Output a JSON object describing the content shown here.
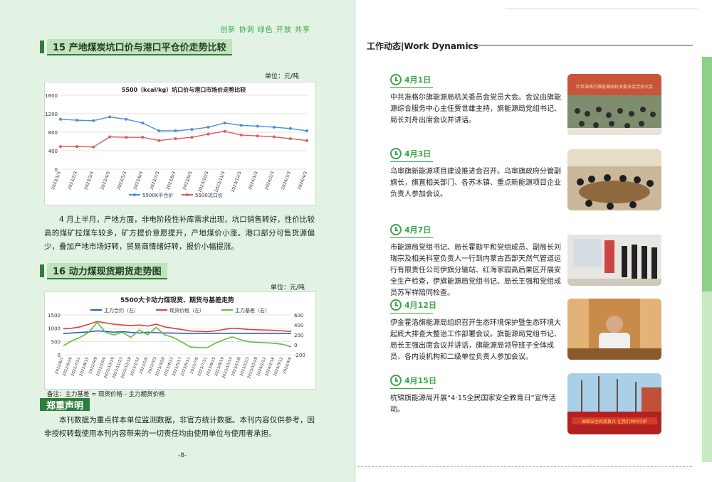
{
  "left_page": {
    "slogan": "创新 协调 绿色 开放 共享",
    "section15": {
      "title": "15 产地煤炭坑口价与港口平仓价走势比较",
      "unit": "单位：元/吨",
      "paragraph": "4 月上半月，产地方面，非电阶段性补库需求出现，坑口销售转好，性价比较高的煤矿拉煤车较多，矿方提价意愿提升，产地煤价小涨。港口部分可售货源偏少，叠加产地市场好转，贸易商情绪好转，报价小幅提涨。"
    },
    "section16": {
      "title": "16 动力煤现货期货走势图",
      "unit": "单位：元/吨",
      "note": "备注：主力基差 = 现货价格 - 主力期货价格"
    },
    "declaration": {
      "title": "郑重声明",
      "text": "本刊数据为重点样本单位监测数据，非官方统计数据。本刊内容仅供参考，因非授权转载使用本刊内容带来的一切责任均由使用单位与使用者承担。"
    },
    "page_number": "-8-"
  },
  "right_page": {
    "title": "工作动态|Work Dynamics",
    "events": [
      {
        "date": "4月1日",
        "text": "中共准格尔旗能源局机关委员会党员大会。会议由旗能源综合服务中心主任贾世雄主持，旗能源局党组书记、局长刘舟出席会议并讲话。",
        "photo_caption": "中共准格尔旗能源局机关委员会党员大会"
      },
      {
        "date": "4月3日",
        "text": "乌审旗新能源项目建设推进会召开。乌审旗政府分管副旗长，旗直相关部门、各苏木镇、重点新能源项目企业负责人参加会议。",
        "photo_caption": ""
      },
      {
        "date": "4月7日",
        "text": "市能源局党组书记、局长霍勘平和党组成员、副局长刘瑞宗及相关科室负责人一行到内蒙古西部天然气管道运行有限责任公司伊旗分输站、红海家园高后果区开展安全生产检查，伊旗能源局党组书记、局长王强和党组成员苏军祥陪同检查。",
        "photo_caption": ""
      },
      {
        "date": "4月12日",
        "text": "伊金霍洛旗能源局组织召开生态环境保护暨生态环境大起底大排查大整治工作部署会议。旗能源局党组书记、局长王强出席会议并讲话，旗能源局领导班子全体成员、各内设机构和二级单位负责人参加会议。",
        "photo_caption": ""
      },
      {
        "date": "4月15日",
        "text": "杭锦旗能源局开展“4·15全民国家安全教育日”宣传活动。",
        "photo_caption": "国家安全民族复兴  让我们共同守护"
      }
    ]
  },
  "chart_data": [
    {
      "type": "line",
      "title": "5500（kcal/kg）坑口价与港口市场价走势比较",
      "x": [
        "2023/1/3",
        "2023/2/3",
        "2023/3/3",
        "2023/4/3",
        "2023/5/3",
        "2023/6/3",
        "2023/7/3",
        "2023/8/3",
        "2023/9/3",
        "2023/10/3",
        "2023/11/3",
        "2023/12/3",
        "2024/1/3",
        "2024/2/3",
        "2024/3/3",
        "2024/4/3"
      ],
      "series": [
        {
          "name": "5500K平仓价",
          "color": "#4a8fd6",
          "values": [
            1080,
            1060,
            1050,
            1130,
            1080,
            1000,
            830,
            830,
            860,
            910,
            1000,
            950,
            930,
            910,
            880,
            830
          ]
        },
        {
          "name": "5500坑口价",
          "color": "#e05a5a",
          "values": [
            490,
            490,
            480,
            700,
            690,
            690,
            620,
            660,
            690,
            760,
            820,
            740,
            720,
            700,
            660,
            620
          ]
        }
      ],
      "ylim": [
        0,
        1600
      ],
      "yticks": [
        0,
        400,
        800,
        1200,
        1600
      ],
      "grid": true,
      "legend": "bottom"
    },
    {
      "type": "line",
      "title": "5500大卡动力煤现货、期货与基差走势",
      "x": [
        "2022/6/1",
        "2022/6/26",
        "2022/7/21",
        "2022/8/15",
        "2022/9/9",
        "2022/10/4",
        "2022/10/29",
        "2022/11/23",
        "2022/12/18",
        "2023/1/12",
        "2023/2/6",
        "2023/3/3",
        "2023/3/28",
        "2023/4/22",
        "2023/5/17",
        "2023/6/11",
        "2023/7/6",
        "2023/7/31",
        "2023/8/25",
        "2023/9/19",
        "2023/10/14",
        "2023/11/8",
        "2023/12/3",
        "2023/12/28",
        "2024/1/22",
        "2024/2/16",
        "2024/3/12",
        "2024/4/6"
      ],
      "series": [
        {
          "name": "主力合约（左）",
          "color": "#2f5cc4",
          "axis": "left",
          "values": [
            800,
            820,
            840,
            860,
            900,
            880,
            850,
            870,
            840,
            820,
            850,
            830,
            820,
            820,
            810,
            810,
            810,
            810,
            810,
            810,
            810,
            810,
            810,
            810,
            810,
            810,
            810,
            810
          ]
        },
        {
          "name": "现货价格（左）",
          "color": "#d9443c",
          "axis": "left",
          "values": [
            980,
            1000,
            1050,
            1150,
            1250,
            1200,
            1150,
            1120,
            1100,
            1120,
            1080,
            1150,
            1050,
            1000,
            950,
            900,
            880,
            870,
            900,
            950,
            1000,
            980,
            950,
            940,
            930,
            920,
            900,
            880
          ]
        },
        {
          "name": "主力基差（右）",
          "color": "#5cbf3c",
          "axis": "right",
          "values": [
            -20,
            80,
            150,
            250,
            450,
            250,
            200,
            250,
            150,
            300,
            200,
            350,
            200,
            150,
            60,
            -40,
            -60,
            -60,
            30,
            100,
            160,
            100,
            60,
            50,
            40,
            30,
            10,
            -40
          ]
        }
      ],
      "ylim": [
        0,
        1500
      ],
      "yticks": [
        0,
        500,
        1000,
        1500
      ],
      "y2lim": [
        -200,
        600
      ],
      "y2ticks": [
        -200,
        0,
        200,
        400,
        600
      ],
      "grid": true,
      "legend": "top"
    }
  ]
}
